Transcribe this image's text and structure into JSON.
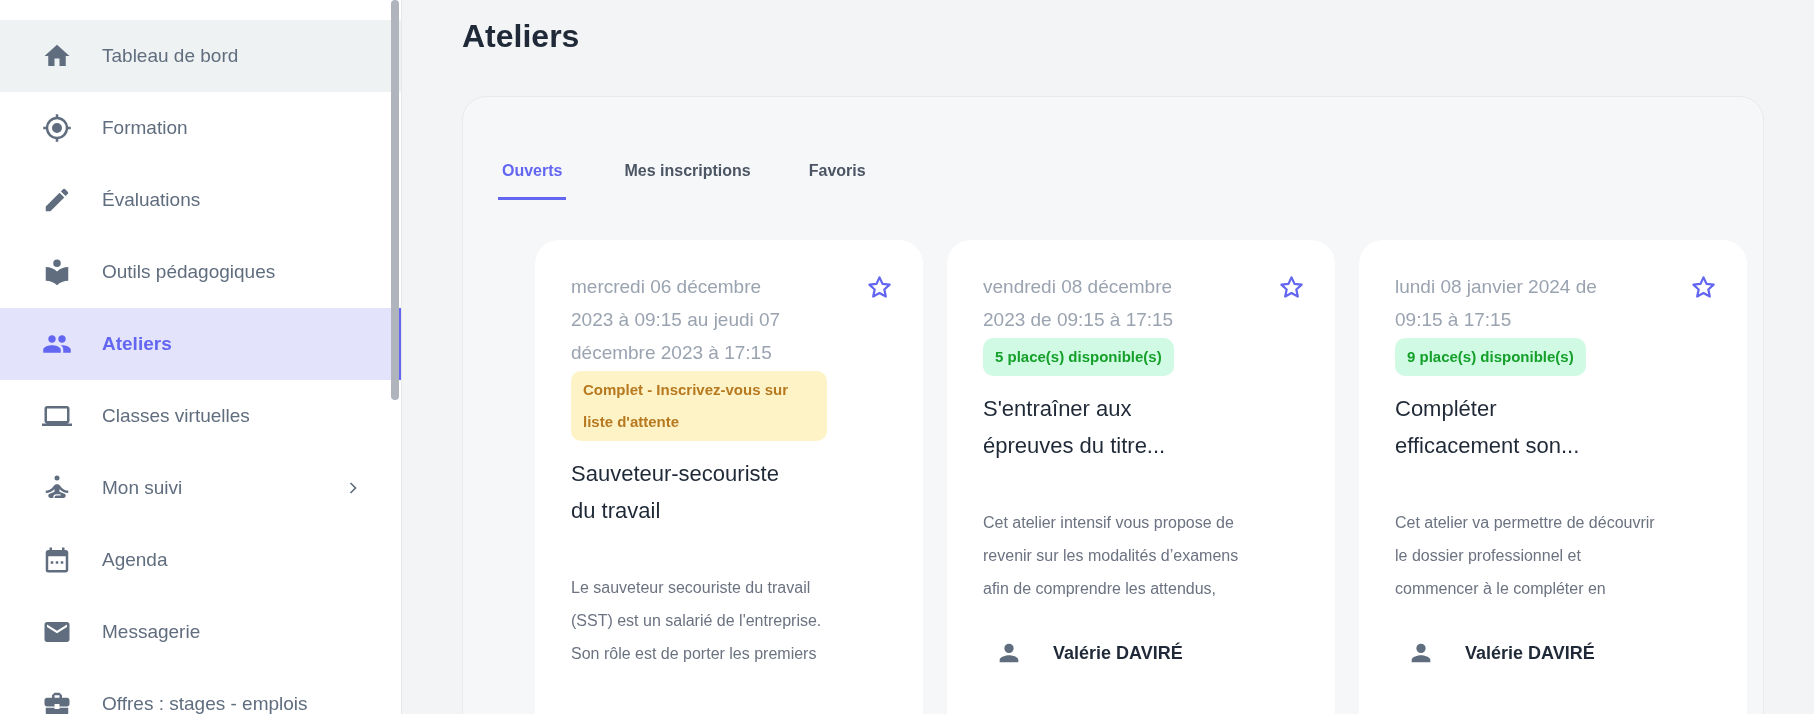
{
  "sidebar": {
    "items": [
      {
        "label": "Tableau de bord",
        "selected": false,
        "hovered": true,
        "has_submenu": false
      },
      {
        "label": "Formation",
        "selected": false,
        "hovered": false,
        "has_submenu": false
      },
      {
        "label": "Évaluations",
        "selected": false,
        "hovered": false,
        "has_submenu": false
      },
      {
        "label": "Outils pédagogiques",
        "selected": false,
        "hovered": false,
        "has_submenu": false
      },
      {
        "label": "Ateliers",
        "selected": true,
        "hovered": false,
        "has_submenu": false
      },
      {
        "label": "Classes virtuelles",
        "selected": false,
        "hovered": false,
        "has_submenu": false
      },
      {
        "label": "Mon suivi",
        "selected": false,
        "hovered": false,
        "has_submenu": true
      },
      {
        "label": "Agenda",
        "selected": false,
        "hovered": false,
        "has_submenu": false
      },
      {
        "label": "Messagerie",
        "selected": false,
        "hovered": false,
        "has_submenu": false
      },
      {
        "label": "Offres : stages - emplois",
        "selected": false,
        "hovered": false,
        "has_submenu": false
      }
    ]
  },
  "page_title": "Ateliers",
  "tabs": [
    {
      "label": "Ouverts",
      "selected": true
    },
    {
      "label": "Mes inscriptions",
      "selected": false
    },
    {
      "label": "Favoris",
      "selected": false
    }
  ],
  "cards": [
    {
      "date": "mercredi 06 décembre 2023 à 09:15 au jeudi 07 décembre 2023 à 17:15",
      "favorite": false,
      "badge": {
        "kind": "full",
        "text": "Complet - Inscrivez-vous sur liste d'attente"
      },
      "title": "Sauveteur-secouriste du travail",
      "description": "Le sauveteur secouriste du travail (SST) est un salarié de l'entreprise. Son rôle est de porter les premiers"
    },
    {
      "date": "vendredi 08 décembre 2023 de 09:15 à 17:15",
      "favorite": false,
      "badge": {
        "kind": "available",
        "text": "5 place(s) disponible(s)"
      },
      "title": "S'entraîner aux épreuves du titre...",
      "description": "Cet atelier intensif vous propose de revenir sur les modalités d’examens afin de comprendre les attendus,",
      "author": "Valérie DAVIRÉ"
    },
    {
      "date": "lundi 08 janvier 2024 de 09:15 à 17:15",
      "favorite": false,
      "badge": {
        "kind": "available",
        "text": "9 place(s) disponible(s)"
      },
      "title": "Compléter efficacement son...",
      "description": "Cet atelier va permettre de découvrir le dossier professionnel et commencer à le compléter en",
      "author": "Valérie DAVIRÉ"
    }
  ]
}
